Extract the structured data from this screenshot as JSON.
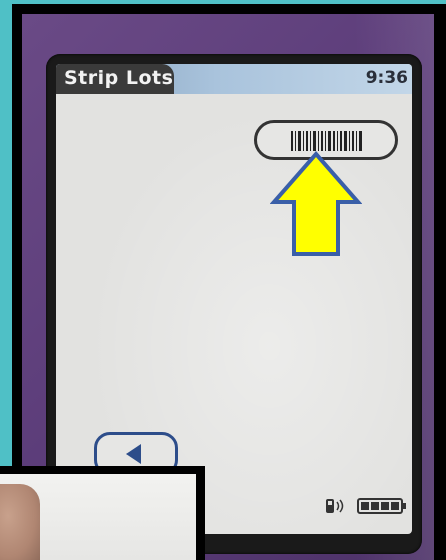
{
  "screen": {
    "title": "Strip Lots",
    "time": "9:36"
  },
  "controls": {
    "barcode_icon": "barcode-icon",
    "back_icon": "left-triangle-icon"
  },
  "status": {
    "signal_icon": "wireless-signal-icon",
    "battery_icon": "battery-icon",
    "battery_level": 1.0
  },
  "annotation": {
    "arrow_icon": "up-arrow-icon",
    "arrow_color": "#ffff00",
    "arrow_outline": "#3a5fa8"
  },
  "colors": {
    "background": "#4fc0c6",
    "device": "#5a3b78",
    "titlebar": "#a9c3dc"
  }
}
